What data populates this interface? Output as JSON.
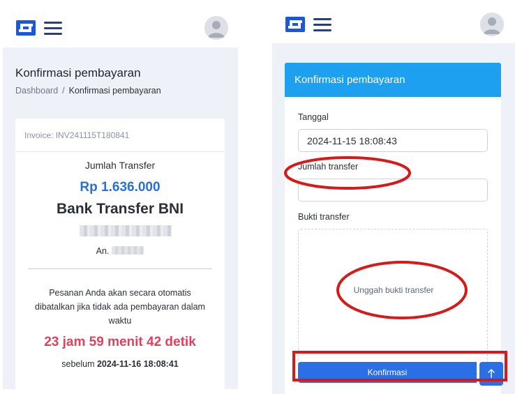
{
  "left_screen": {
    "header": {
      "logo_icon": "s-logo-icon",
      "menu_icon": "hamburger-menu-icon",
      "avatar_icon": "user-avatar-icon"
    },
    "page_title": "Konfirmasi pembayaran",
    "breadcrumb": {
      "home": "Dashboard",
      "separator": "/",
      "current": "Konfirmasi pembayaran"
    },
    "invoice": {
      "number": "Invoice: INV241115T180841",
      "transfer_label": "Jumlah Transfer",
      "amount": "Rp 1.636.000",
      "bank": "Bank Transfer BNI",
      "holder_prefix": "An.",
      "notice": "Pesanan Anda akan secara otomatis dibatalkan jika tidak ada pembayaran dalam waktu",
      "countdown": "23 jam 59 menit 42 detik",
      "deadline_prefix": "sebelum",
      "deadline": "2024-11-16 18:08:41"
    }
  },
  "right_screen": {
    "header": {
      "logo_icon": "s-logo-icon",
      "menu_icon": "hamburger-menu-icon",
      "avatar_icon": "user-avatar-icon"
    },
    "form": {
      "title": "Konfirmasi pembayaran",
      "date_label": "Tanggal",
      "date_value": "2024-11-15 18:08:43",
      "amount_label": "Jumlah transfer",
      "amount_value": "",
      "proof_label": "Bukti transfer",
      "upload_text": "Unggah bukti transfer",
      "submit_label": "Konfirmasi",
      "scroll_top_icon": "arrow-up-icon"
    }
  },
  "colors": {
    "brand_blue": "#1a56e0",
    "header_blue": "#1ea0f0",
    "amount_blue": "#2a6fd6",
    "countdown_red": "#e0425c",
    "annotation_red": "#d61a1a",
    "page_bg": "#eef1f8"
  }
}
